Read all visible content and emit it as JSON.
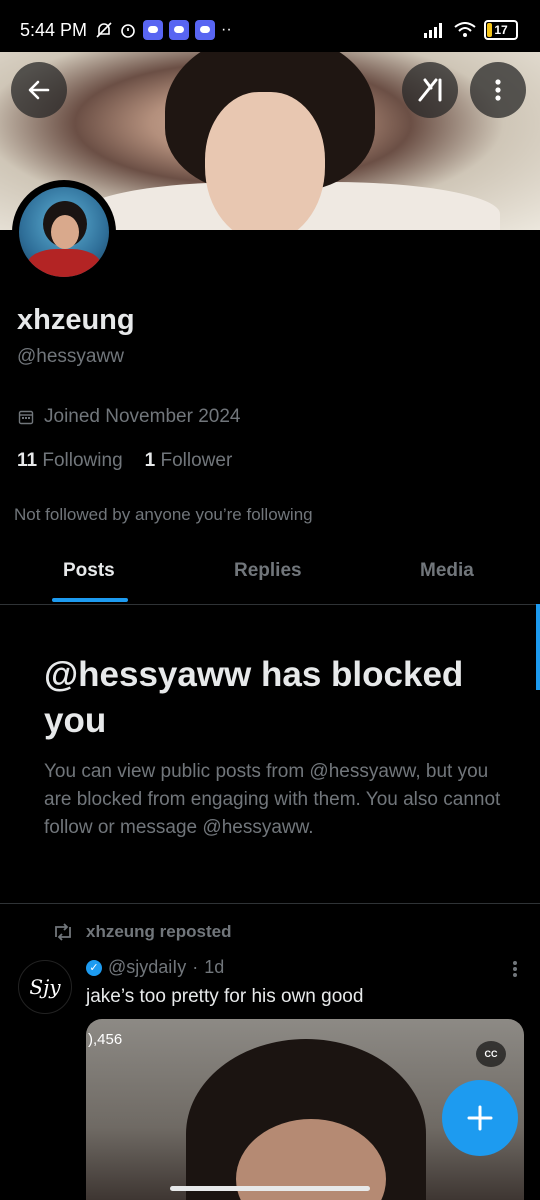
{
  "status_bar": {
    "time": "5:44 PM",
    "icons": [
      "mute-bell-icon",
      "alarm-icon",
      "discord-icon",
      "discord-icon",
      "discord-icon",
      "more-dots"
    ],
    "right_icons": [
      "signal-icon",
      "wifi-icon",
      "battery-icon"
    ],
    "battery_level": "17"
  },
  "header": {
    "back_icon": "arrow-left-icon",
    "grok_icon": "grok-icon",
    "more_icon": "more-vertical-icon"
  },
  "profile": {
    "display_name": "xhzeung",
    "handle": "@hessyaww",
    "joined": "Joined November 2024",
    "following_count": "11",
    "following_label": "Following",
    "followers_count": "1",
    "followers_label": "Follower",
    "not_followed_text": "Not followed by anyone you’re following"
  },
  "tabs": [
    {
      "label": "Posts",
      "active": true
    },
    {
      "label": "Replies",
      "active": false
    },
    {
      "label": "Media",
      "active": false
    }
  ],
  "blocked": {
    "title": "@hessyaww has blocked you",
    "body": "You can view public posts from @hessyaww, but you are blocked from engaging with them. You also cannot follow or message @hessyaww."
  },
  "post": {
    "repost_label": "xhzeung reposted",
    "avatar_text": "Sjy",
    "author_handle": "@sjydaiIy",
    "time": "1d",
    "text": "jake’s too pretty for his own good",
    "view_count": "),456",
    "cc_label": "CC"
  },
  "colors": {
    "accent": "#1d9bf0",
    "background": "#000000",
    "secondary_text": "#71767b"
  }
}
